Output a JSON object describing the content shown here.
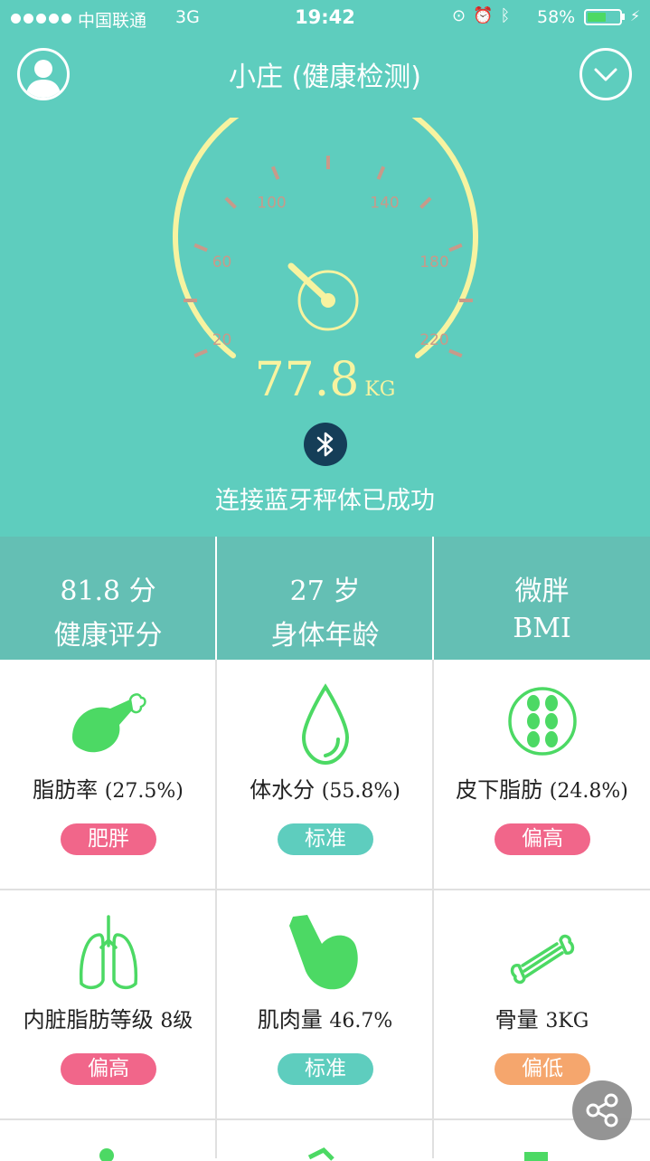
{
  "status_bar": {
    "carrier": "中国联通",
    "network": "3G",
    "time": "19:42",
    "battery_pct": "58%",
    "battery_level": 0.58
  },
  "header": {
    "title": "小庄 (健康检测)"
  },
  "gauge": {
    "tick_labels": [
      "20",
      "60",
      "100",
      "140",
      "180",
      "220"
    ],
    "weight_value": "77.8",
    "weight_unit": "KG",
    "arc_color": "#f7f3a0"
  },
  "connection": {
    "status_text": "连接蓝牙秤体已成功"
  },
  "stats": [
    {
      "value": "81.8 分",
      "label": "健康评分"
    },
    {
      "value": "27 岁",
      "label": "身体年龄"
    },
    {
      "value": "微胖",
      "label": "BMI"
    }
  ],
  "metrics": [
    {
      "name": "脂肪率",
      "value": "(27.5%)",
      "status": "肥胖",
      "status_color": "#f1668a",
      "icon": "drumstick-icon"
    },
    {
      "name": "体水分",
      "value": "(55.8%)",
      "status": "标准",
      "status_color": "#5ecdbe",
      "icon": "water-drop-icon"
    },
    {
      "name": "皮下脂肪",
      "value": "(24.8%)",
      "status": "偏高",
      "status_color": "#f1668a",
      "icon": "fat-cells-icon"
    },
    {
      "name": "内脏脂肪等级",
      "value": "8级",
      "status": "偏高",
      "status_color": "#f1668a",
      "icon": "lungs-icon"
    },
    {
      "name": "肌肉量",
      "value": "46.7%",
      "status": "标准",
      "status_color": "#5ecdbe",
      "icon": "muscle-arm-icon"
    },
    {
      "name": "骨量",
      "value": "3KG",
      "status": "偏低",
      "status_color": "#f5a66d",
      "icon": "bone-icon"
    }
  ],
  "colors": {
    "theme": "#5ecdbe",
    "icon_green": "#4cd964"
  }
}
